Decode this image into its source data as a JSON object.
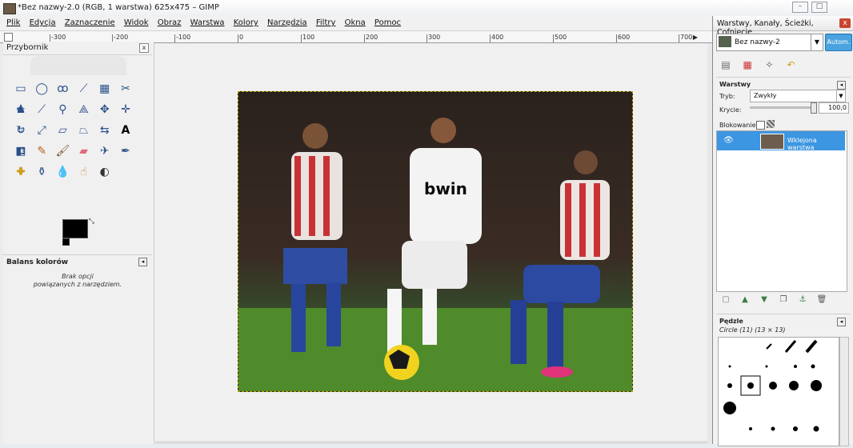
{
  "window": {
    "title": "*Bez nazwy-2.0 (RGB, 1 warstwa) 625x475 – GIMP"
  },
  "menu": [
    "Plik",
    "Edycja",
    "Zaznaczenie",
    "Widok",
    "Obraz",
    "Warstwa",
    "Kolory",
    "Narzędzia",
    "Filtry",
    "Okna",
    "Pomoc"
  ],
  "ruler": {
    "ticks": [
      "-300",
      "-200",
      "-100",
      "0",
      "100",
      "200",
      "300",
      "400",
      "500",
      "600",
      "700"
    ]
  },
  "toolbox": {
    "title": "Przybornik",
    "tool_options": {
      "title": "Balans kolorów",
      "note_line1": "Brak opcji",
      "note_line2": "powiązanych z narzędziem."
    }
  },
  "dock": {
    "title": "Warstwy, Kanały, Ścieżki, Cofnięcie...",
    "image_selector": "Bez nazwy-2",
    "auto_button": "Autom.",
    "layers": {
      "title": "Warstwy",
      "mode_label": "Tryb:",
      "mode_value": "Zwykły",
      "opacity_label": "Krycie:",
      "opacity_value": "100,0",
      "lock_label": "Blokowanie:",
      "layer_name": "Wklejona warstwa"
    },
    "brushes": {
      "title": "Pędzle",
      "selected": "Circle (11) (13 × 13)"
    }
  },
  "colors": {
    "accent": "#3d96e1",
    "foreground": "#000000",
    "background": "#ffffff"
  }
}
